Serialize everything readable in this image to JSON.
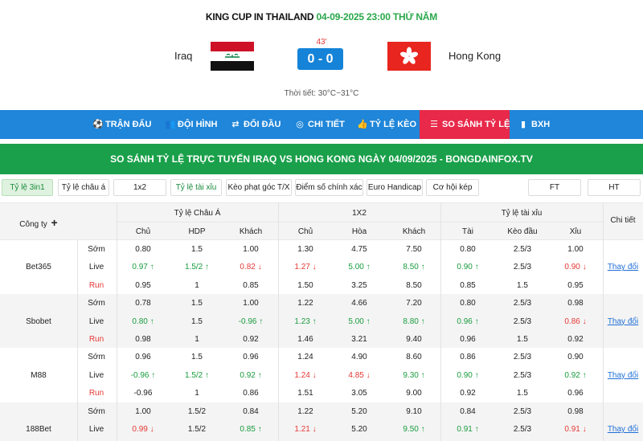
{
  "match": {
    "league": "KING CUP IN THAILAND",
    "datetime": "04-09-2025 23:00 THỨ NĂM",
    "home": "Iraq",
    "away": "Hong Kong",
    "minute": "43'",
    "score": "0 - 0",
    "weather": "Thời tiết: 30°C~31°C"
  },
  "nav": [
    {
      "label": "TRẬN ĐẤU",
      "icon": "ball-icon"
    },
    {
      "label": "ĐỘI HÌNH",
      "icon": "team-icon"
    },
    {
      "label": "ĐỐI ĐẦU",
      "icon": "versus-icon"
    },
    {
      "label": "CHI TIẾT",
      "icon": "detail-icon"
    },
    {
      "label": "TỶ LỆ KÈO",
      "icon": "thumb-icon"
    },
    {
      "label": "SO SÁNH TỶ LỆ",
      "icon": "compare-icon"
    },
    {
      "label": "BXH",
      "icon": "chart-icon"
    }
  ],
  "banner": "SO SÁNH TỶ LỆ TRỰC TUYẾN IRAQ VS HONG KONG NGÀY 04/09/2025 - BONGDAINFOX.TV",
  "filters": [
    "Tỷ lệ 3in1",
    "Tỷ lệ châu á",
    "1x2",
    "Tỷ lệ tài xỉu",
    "Kèo phạt góc T/X",
    "Điểm số chính xác",
    "Euro Handicap",
    "Cơ hội kép",
    "FT",
    "HT"
  ],
  "table": {
    "company_header": "Công ty",
    "group_asia": "Tỷ lệ Châu Á",
    "group_1x2": "1X2",
    "group_ou": "Tỷ lệ tài xỉu",
    "detail_header": "Chi tiết",
    "sub_headers": [
      "Chủ",
      "HDP",
      "Khách",
      "Chủ",
      "Hòa",
      "Khách",
      "Tài",
      "Kèo đầu",
      "Xỉu"
    ],
    "row_labels": [
      "Sớm",
      "Live",
      "Run"
    ],
    "detail_link": "Thay đổi",
    "companies": [
      {
        "name": "Bet365",
        "rows": [
          [
            "0.80",
            "1.5",
            "1.00",
            "1.30",
            "4.75",
            "7.50",
            "0.80",
            "2.5/3",
            "1.00"
          ],
          [
            "0.97 ↑",
            "1.5/2 ↑",
            "0.82 ↓",
            "1.27 ↓",
            "5.00 ↑",
            "8.50 ↑",
            "0.90 ↑",
            "2.5/3",
            "0.90 ↓"
          ],
          [
            "0.95",
            "1",
            "0.85",
            "1.50",
            "3.25",
            "8.50",
            "0.85",
            "1.5",
            "0.95"
          ]
        ],
        "dirs": [
          [
            "",
            "",
            "",
            "",
            "",
            "",
            "",
            "",
            ""
          ],
          [
            "up",
            "up",
            "down",
            "down",
            "up",
            "up",
            "up",
            "",
            "down"
          ],
          [
            "",
            "",
            "",
            "",
            "",
            "",
            "",
            "",
            ""
          ]
        ]
      },
      {
        "name": "Sbobet",
        "rows": [
          [
            "0.78",
            "1.5",
            "1.00",
            "1.22",
            "4.66",
            "7.20",
            "0.80",
            "2.5/3",
            "0.98"
          ],
          [
            "0.80 ↑",
            "1.5",
            "-0.96 ↑",
            "1.23 ↑",
            "5.00 ↑",
            "8.80 ↑",
            "0.96 ↑",
            "2.5/3",
            "0.86 ↓"
          ],
          [
            "0.98",
            "1",
            "0.92",
            "1.46",
            "3.21",
            "9.40",
            "0.96",
            "1.5",
            "0.92"
          ]
        ],
        "dirs": [
          [
            "",
            "",
            "",
            "",
            "",
            "",
            "",
            "",
            ""
          ],
          [
            "up",
            "",
            "up",
            "up",
            "up",
            "up",
            "up",
            "",
            "down"
          ],
          [
            "",
            "",
            "",
            "",
            "",
            "",
            "",
            "",
            ""
          ]
        ]
      },
      {
        "name": "M88",
        "rows": [
          [
            "0.96",
            "1.5",
            "0.96",
            "1.24",
            "4.90",
            "8.60",
            "0.86",
            "2.5/3",
            "0.90"
          ],
          [
            "-0.96 ↑",
            "1.5/2 ↑",
            "0.92 ↑",
            "1.24 ↓",
            "4.85 ↓",
            "9.30 ↑",
            "0.90 ↑",
            "2.5/3",
            "0.92 ↑"
          ],
          [
            "-0.96",
            "1",
            "0.86",
            "1.51",
            "3.05",
            "9.00",
            "0.92",
            "1.5",
            "0.96"
          ]
        ],
        "dirs": [
          [
            "",
            "",
            "",
            "",
            "",
            "",
            "",
            "",
            ""
          ],
          [
            "up",
            "up",
            "up",
            "down",
            "down",
            "up",
            "up",
            "",
            "up"
          ],
          [
            "",
            "",
            "",
            "",
            "",
            "",
            "",
            "",
            ""
          ]
        ]
      },
      {
        "name": "188Bet",
        "rows": [
          [
            "1.00",
            "1.5/2",
            "0.84",
            "1.22",
            "5.20",
            "9.10",
            "0.84",
            "2.5/3",
            "0.98"
          ],
          [
            "0.99 ↓",
            "1.5/2",
            "0.85 ↑",
            "1.21 ↓",
            "5.20",
            "9.50 ↑",
            "0.91 ↑",
            "2.5/3",
            "0.91 ↓"
          ]
        ],
        "dirs": [
          [
            "",
            "",
            "",
            "",
            "",
            "",
            "",
            "",
            ""
          ],
          [
            "down",
            "",
            "up",
            "down",
            "",
            "up",
            "up",
            "",
            "down"
          ]
        ]
      }
    ]
  }
}
